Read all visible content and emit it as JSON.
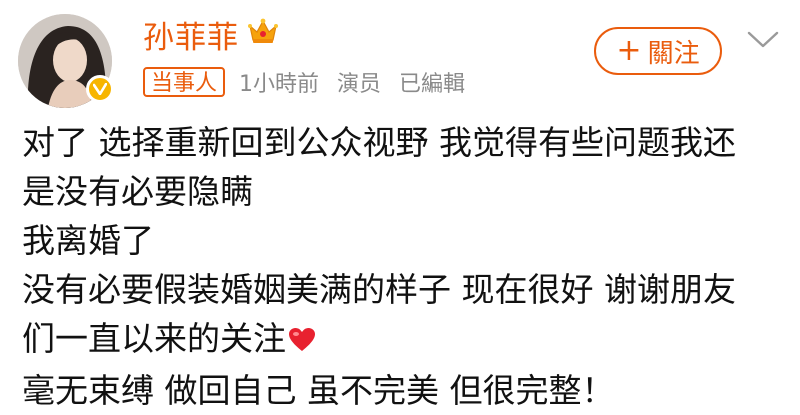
{
  "user": {
    "name": "孙菲菲",
    "avatar_icon": "portrait-avatar",
    "badge_icon": "crown-icon",
    "verified_icon": "verified-v-icon"
  },
  "meta": {
    "tag": "当事人",
    "time": "1小時前",
    "role": "演员",
    "edited": "已編輯"
  },
  "follow": {
    "plus": "+",
    "label": "關注"
  },
  "post": {
    "lines": [
      "对了 选择重新回到公众视野 我觉得有些问题我还",
      "是没有必要隐瞒",
      "我离婚了",
      "没有必要假装婚姻美满的样子 现在很好 谢谢朋友",
      "们一直以来的关注",
      "毫无束缚 做回自己 虽不完美 但很完整！"
    ],
    "emoji_icon": "red-heart-icon"
  },
  "colors": {
    "accent": "#ea5c0d",
    "meta_gray": "#8a8a8a",
    "verified_gold": "#f7b500",
    "heart_red": "#e8212f"
  }
}
